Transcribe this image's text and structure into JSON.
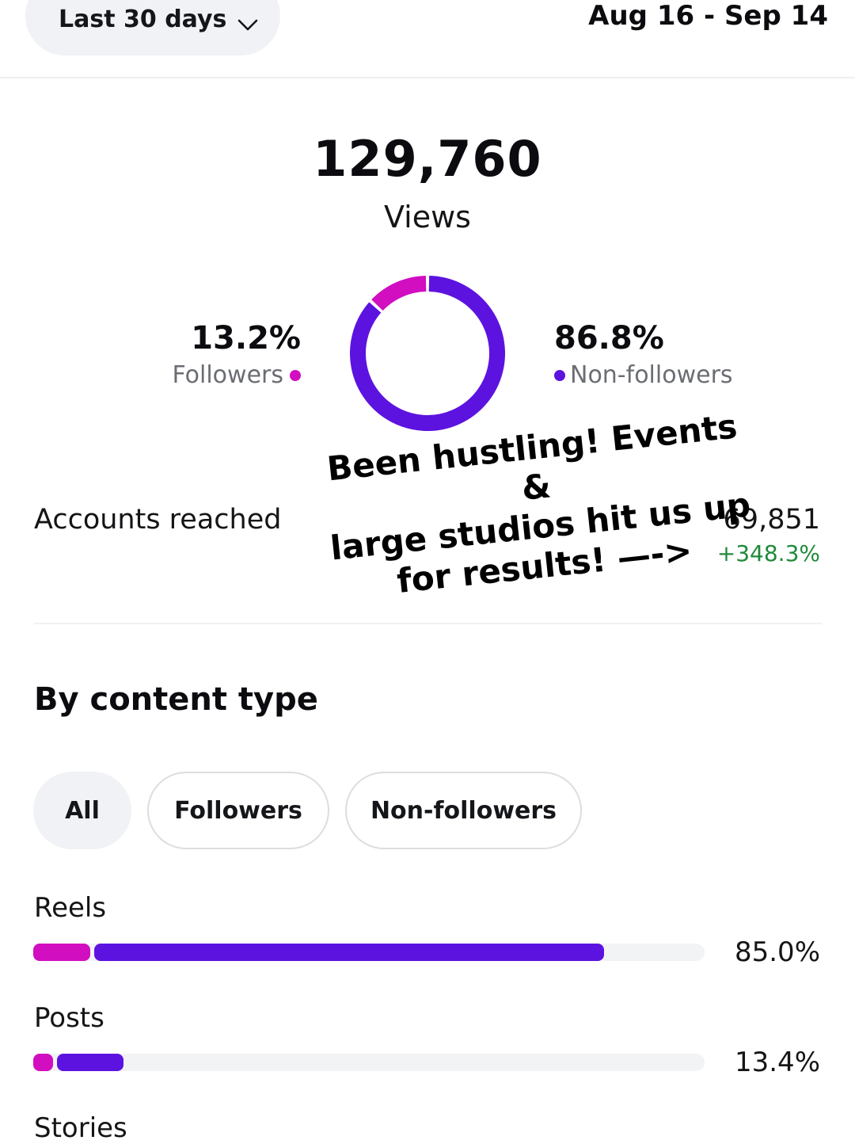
{
  "header": {
    "range_label": "Last 30 days",
    "date_range": "Aug 16 - Sep 14"
  },
  "views": {
    "total": "129,760",
    "label": "Views",
    "followers_pct_text": "13.2%",
    "followers_label": "Followers",
    "nonfollowers_pct_text": "86.8%",
    "nonfollowers_label": "Non-followers",
    "followers_share": 0.132,
    "nonfollowers_share": 0.868
  },
  "accounts_reached": {
    "label": "Accounts reached",
    "value": "69,851",
    "change": "+348.3%"
  },
  "overlay": {
    "line1": "Been hustling! Events &",
    "line2": "large studios hit us up",
    "line3": "for results! —->"
  },
  "content_type": {
    "title": "By content type",
    "chips": [
      "All",
      "Followers",
      "Non-followers"
    ],
    "selected_chip": "All",
    "rows": [
      {
        "label": "Reels",
        "pct_text": "85.0%",
        "total": 0.85,
        "followers": 0.085
      },
      {
        "label": "Posts",
        "pct_text": "13.4%",
        "total": 0.134,
        "followers": 0.03
      },
      {
        "label": "Stories"
      }
    ]
  },
  "colors": {
    "followers": "#d10ec0",
    "nonfollowers": "#5c13e0",
    "positive": "#1f8a3a"
  },
  "icons": {
    "range_chevron": "chevron-down-icon"
  }
}
